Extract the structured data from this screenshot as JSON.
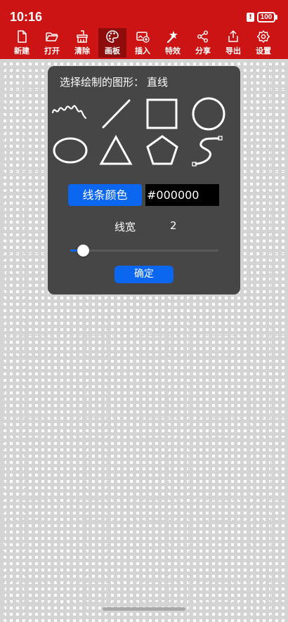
{
  "status_bar": {
    "time": "10:16",
    "battery_alert": "!",
    "battery_level": "100"
  },
  "toolbar": {
    "items": [
      {
        "label": "新建",
        "icon": "new-file-icon"
      },
      {
        "label": "打开",
        "icon": "folder-open-icon"
      },
      {
        "label": "清除",
        "icon": "clear-brush-icon"
      },
      {
        "label": "画板",
        "icon": "palette-icon",
        "active": true
      },
      {
        "label": "插入",
        "icon": "insert-image-icon"
      },
      {
        "label": "特效",
        "icon": "magic-wand-icon"
      },
      {
        "label": "分享",
        "icon": "share-icon"
      },
      {
        "label": "导出",
        "icon": "export-icon"
      },
      {
        "label": "设置",
        "icon": "gear-icon"
      }
    ]
  },
  "dialog": {
    "title_prefix": "选择绘制的图形：",
    "selected_shape": "直线",
    "shapes": [
      "freehand",
      "line",
      "rectangle",
      "circle",
      "ellipse",
      "triangle",
      "pentagon",
      "bezier-curve"
    ],
    "color_button_label": "线条颜色",
    "color_value": "#000000",
    "line_width_label": "线宽",
    "line_width_value": "2",
    "line_width_fraction": 0.05,
    "confirm_label": "确定"
  },
  "colors": {
    "appbar": "#cc1414",
    "active_tool": "#8e0c0c",
    "dialog_bg": "#464646",
    "accent": "#0b66f0",
    "swatch": "#000000"
  }
}
